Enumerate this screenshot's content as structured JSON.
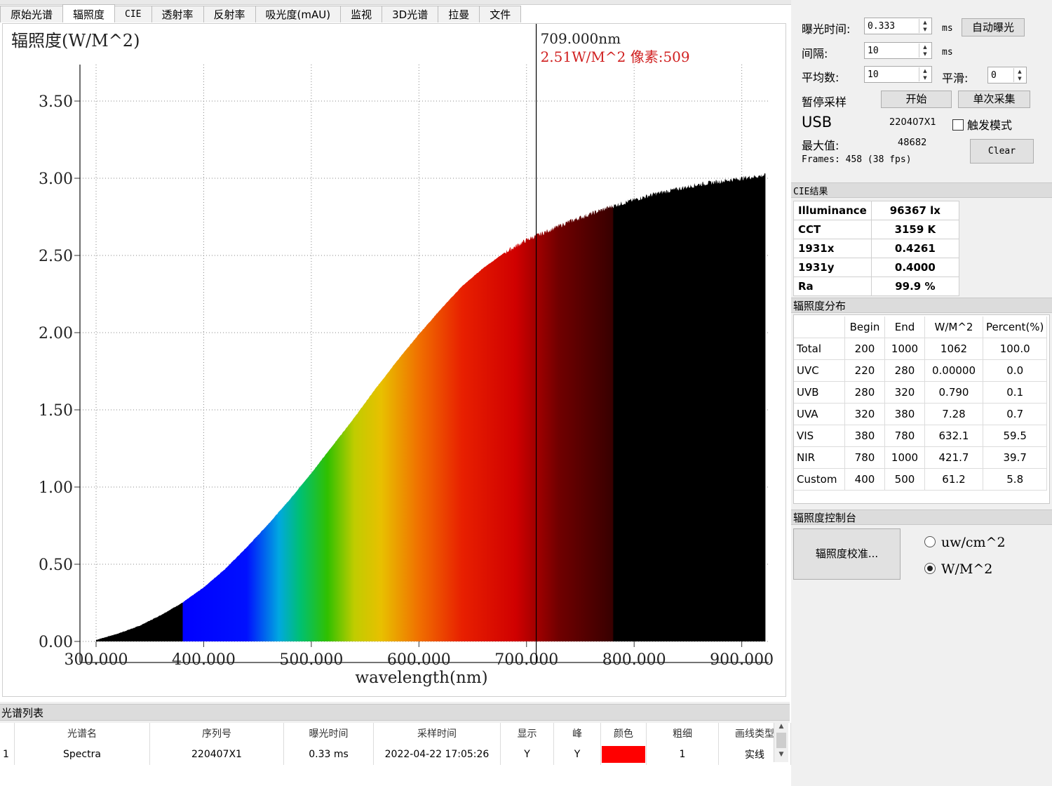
{
  "tabs": [
    "原始光谱",
    "辐照度",
    "CIE",
    "透射率",
    "反射率",
    "吸光度(mAU)",
    "监视",
    "3D光谱",
    "拉曼",
    "文件"
  ],
  "chart_data": {
    "type": "area",
    "title": "辐照度(W/M^2)",
    "xlabel": "wavelength(nm)",
    "ylabel": "",
    "xlim": [
      285,
      925
    ],
    "ylim": [
      0,
      3.5
    ],
    "x_ticks": [
      "300.000",
      "400.000",
      "500.000",
      "600.000",
      "700.000",
      "800.000",
      "900.000"
    ],
    "y_ticks": [
      "3.50",
      "3.00",
      "2.50",
      "2.00",
      "1.50",
      "1.00",
      "0.50",
      "0.00"
    ],
    "grid": true,
    "series": [
      {
        "x": [
          300,
          320,
          340,
          360,
          380,
          400,
          420,
          440,
          460,
          480,
          500,
          520,
          540,
          560,
          580,
          600,
          620,
          640,
          660,
          680,
          700,
          720,
          740,
          760,
          780,
          800,
          820,
          840,
          860,
          880,
          900,
          922
        ],
        "values": [
          0.01,
          0.05,
          0.1,
          0.17,
          0.25,
          0.35,
          0.47,
          0.61,
          0.76,
          0.92,
          1.09,
          1.27,
          1.45,
          1.64,
          1.82,
          1.99,
          2.15,
          2.3,
          2.42,
          2.52,
          2.6,
          2.66,
          2.72,
          2.77,
          2.82,
          2.86,
          2.9,
          2.93,
          2.96,
          2.98,
          3.0,
          3.02
        ]
      }
    ],
    "cursor": {
      "x": 709.0,
      "label": "709.000nm",
      "value_label": "2.51W/M^2 像素:509"
    }
  },
  "controls": {
    "exposure_label": "曝光时间:",
    "exposure_value": "0.333",
    "exposure_unit": "ms",
    "auto_exposure_button": "自动曝光",
    "interval_label": "间隔:",
    "interval_value": "10",
    "interval_unit": "ms",
    "average_label": "平均数:",
    "average_value": "10",
    "smooth_label": "平滑:",
    "smooth_value": "0",
    "pause_label": "暂停采样",
    "start_button": "开始",
    "single_button": "单次采集",
    "usb_label": "USB",
    "serial": "220407X1",
    "trigger_label": "触发模式",
    "max_label": "最大值:",
    "max_value": "48682",
    "frames_text": "Frames: 458 (38 fps)",
    "clear_button": "Clear"
  },
  "cie": {
    "header": "CIE结果",
    "rows": [
      [
        "Illuminance",
        "96367 lx"
      ],
      [
        "CCT",
        "3159 K"
      ],
      [
        "1931x",
        "0.4261"
      ],
      [
        "1931y",
        "0.4000"
      ],
      [
        "Ra",
        "99.9 %"
      ]
    ]
  },
  "distribution": {
    "header": "辐照度分布",
    "columns": [
      "",
      "Begin",
      "End",
      "W/M^2",
      "Percent(%)"
    ],
    "rows": [
      [
        "Total",
        "200",
        "1000",
        "1062",
        "100.0"
      ],
      [
        "UVC",
        "220",
        "280",
        "0.00000",
        "0.0"
      ],
      [
        "UVB",
        "280",
        "320",
        "0.790",
        "0.1"
      ],
      [
        "UVA",
        "320",
        "380",
        "7.28",
        "0.7"
      ],
      [
        "VIS",
        "380",
        "780",
        "632.1",
        "59.5"
      ],
      [
        "NIR",
        "780",
        "1000",
        "421.7",
        "39.7"
      ],
      [
        "Custom",
        "400",
        "500",
        "61.2",
        "5.8"
      ]
    ]
  },
  "console": {
    "header": "辐照度控制台",
    "calibrate_button": "辐照度校准...",
    "unit_options": [
      "uw/cm^2",
      "W/M^2"
    ],
    "selected_unit": "W/M^2"
  },
  "spectrum_list": {
    "header": "光谱列表",
    "columns": [
      "光谱名",
      "序列号",
      "曝光时间",
      "采样时间",
      "显示",
      "峰",
      "颜色",
      "粗细",
      "画线类型"
    ],
    "rows": [
      {
        "index": "1",
        "name": "Spectra",
        "serial": "220407X1",
        "exposure": "0.33 ms",
        "time": "2022-04-22 17:05:26",
        "show": "Y",
        "peak": "Y",
        "color": "#ff0000",
        "width": "1",
        "line_type": "实线"
      }
    ]
  }
}
